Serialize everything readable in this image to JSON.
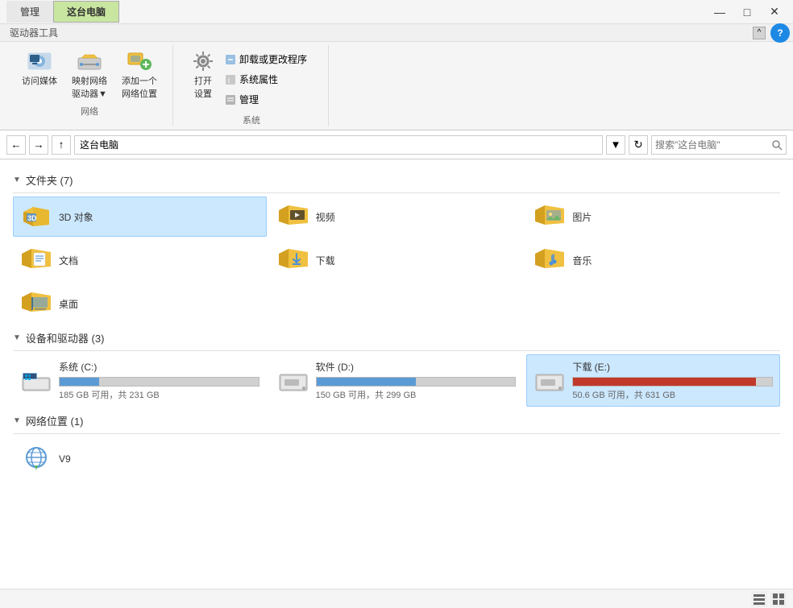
{
  "titleBar": {
    "tabs": [
      "管理",
      "这台电脑"
    ],
    "activeTab": 1,
    "controls": [
      "—",
      "□",
      "✕"
    ]
  },
  "ribbon": {
    "subLabel": "驱动器工具",
    "groups": [
      {
        "name": "网络",
        "items": [
          {
            "id": "media-btn",
            "icon": "media",
            "label": "访问媒体"
          },
          {
            "id": "map-btn",
            "icon": "map",
            "label": "映射网络\n驱动器▼"
          },
          {
            "id": "add-btn",
            "icon": "add",
            "label": "添加一个\n网络位置"
          }
        ]
      },
      {
        "name": "系统",
        "items": [
          {
            "id": "open-btn",
            "icon": "open",
            "label": "打开\n设置",
            "subItems": [
              "卸载或更改程序",
              "系统属性",
              "管理"
            ]
          }
        ]
      }
    ],
    "collapseBtn": "^",
    "helpBtn": "?"
  },
  "addressBar": {
    "path": "这台电脑",
    "searchPlaceholder": "搜索\"这台电脑\""
  },
  "sections": {
    "folders": {
      "header": "文件夹 (7)",
      "items": [
        {
          "id": "3d",
          "name": "3D 对象",
          "selected": true
        },
        {
          "id": "video",
          "name": "视频"
        },
        {
          "id": "pictures",
          "name": "图片"
        },
        {
          "id": "docs",
          "name": "文档"
        },
        {
          "id": "downloads",
          "name": "下载"
        },
        {
          "id": "music",
          "name": "音乐"
        },
        {
          "id": "desktop",
          "name": "桌面"
        }
      ]
    },
    "drives": {
      "header": "设备和驱动器 (3)",
      "items": [
        {
          "id": "c",
          "name": "系统 (C:)",
          "usedPct": 20,
          "status": "ok",
          "freeGB": 185,
          "totalGB": 231
        },
        {
          "id": "d",
          "name": "软件 (D:)",
          "usedPct": 50,
          "status": "ok",
          "freeGB": 150,
          "totalGB": 299
        },
        {
          "id": "e",
          "name": "下载 (E:)",
          "usedPct": 92,
          "status": "warning",
          "freeGB": 50.6,
          "totalGB": 631,
          "selected": true
        }
      ]
    },
    "network": {
      "header": "网络位置 (1)",
      "items": [
        {
          "id": "v9",
          "name": "V9"
        }
      ]
    }
  },
  "statusBar": {
    "viewIcons": [
      "list-view",
      "detail-view"
    ]
  }
}
